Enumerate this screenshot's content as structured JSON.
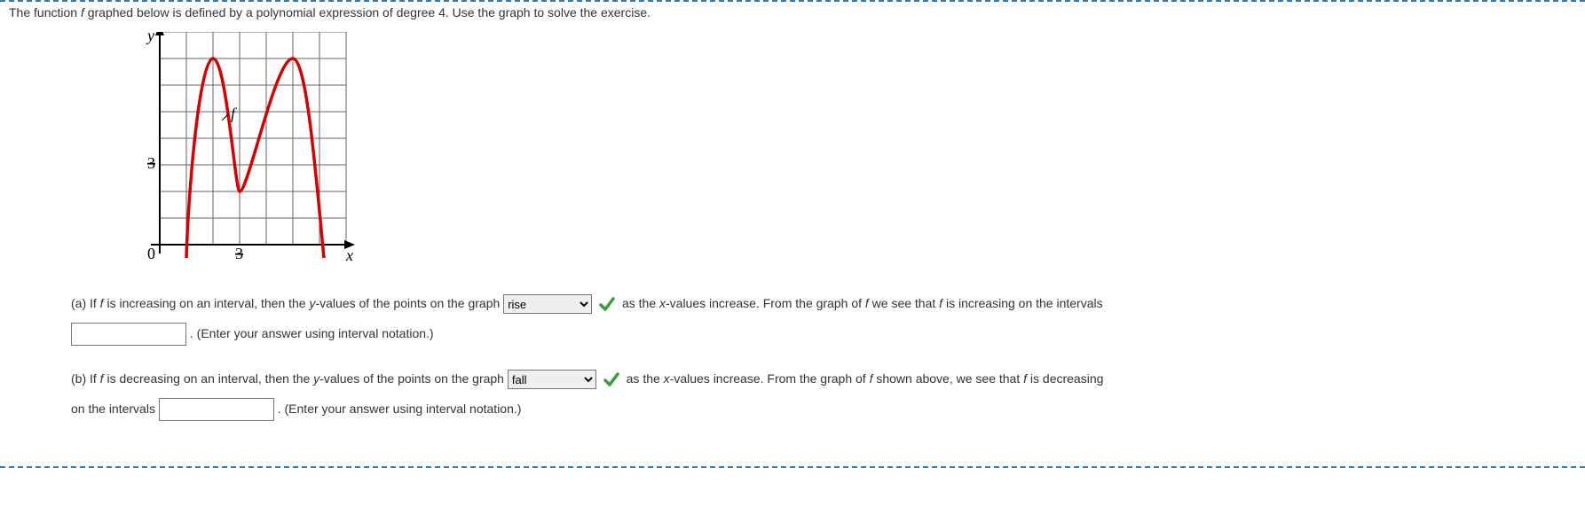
{
  "statement": {
    "pre": "The function ",
    "f": "f",
    "mid": " graphed below is defined by a polynomial expression of degree 4. Use the graph to solve the exercise."
  },
  "graph": {
    "y_label": "y",
    "x_label": "x",
    "curve_label": "f",
    "x_tick": "3",
    "y_tick": "3",
    "origin": "0"
  },
  "qa": {
    "label": "(a) If ",
    "f1": "f",
    "t1": " is increasing on an interval, then the ",
    "yv": "y",
    "t2": "-values of the points on the graph ",
    "select_value": "rise",
    "t3": " as the ",
    "xv": "x",
    "t4": "-values increase. From the graph of ",
    "f2": "f",
    "t5": " we see that ",
    "f3": "f",
    "t6": " is increasing on the intervals",
    "input_value": "",
    "t7": ". (Enter your answer using interval notation.)"
  },
  "qb": {
    "label": "(b) If ",
    "f1": "f",
    "t1": " is decreasing on an interval, then the ",
    "yv": "y",
    "t2": "-values of the points on the graph ",
    "select_value": "fall",
    "t3": " as the ",
    "xv": "x",
    "t4": "-values increase. From the graph of ",
    "f2": "f",
    "t5": " shown above, we see that ",
    "f3": "f",
    "t6": " is decreasing",
    "t7": "on the intervals ",
    "input_value": "",
    "t8": ". (Enter your answer using interval notation.)"
  },
  "chart_data": {
    "type": "line",
    "title": "",
    "xlabel": "x",
    "ylabel": "y",
    "xlim": [
      0,
      7
    ],
    "ylim": [
      0,
      8
    ],
    "x_ticks": [
      3
    ],
    "y_ticks": [
      3
    ],
    "series": [
      {
        "name": "f",
        "x": [
          1,
          2,
          3,
          5,
          6
        ],
        "y": [
          0,
          7,
          2,
          7,
          0
        ]
      }
    ]
  }
}
